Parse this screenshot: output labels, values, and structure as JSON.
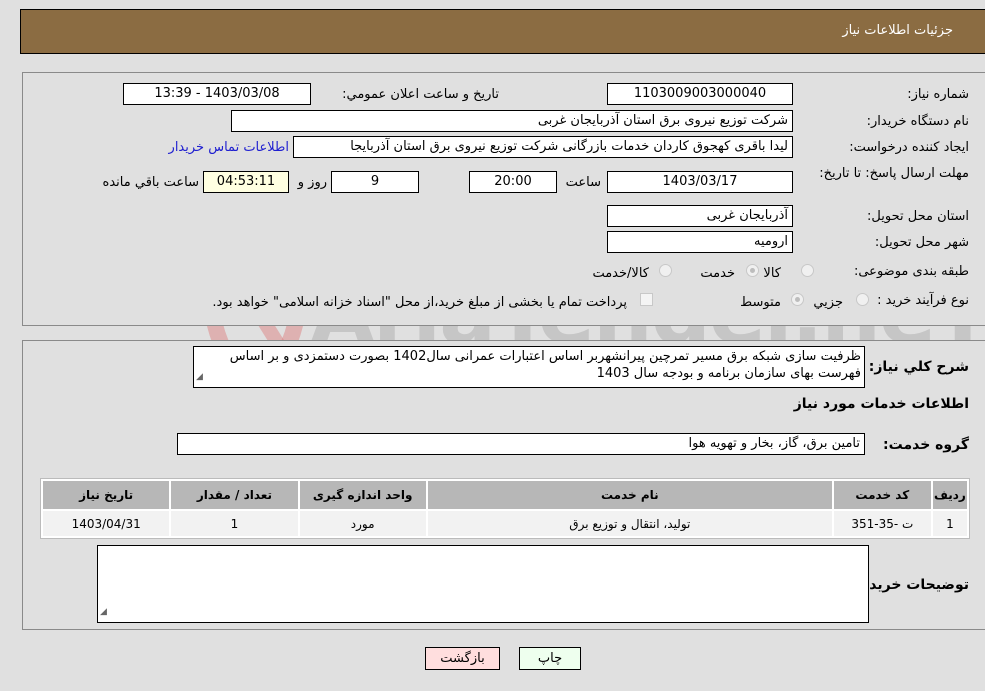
{
  "header": {
    "title": "جزئیات اطلاعات نیاز"
  },
  "details": {
    "need_number": {
      "label": "شماره نیاز:",
      "value": "1103009003000040"
    },
    "announce_datetime": {
      "label": "تاريخ و ساعت اعلان عمومي:",
      "value": "1403/03/08 - 13:39"
    },
    "buyer_org": {
      "label": "نام دستگاه خريدار:",
      "value": "شرکت توزیع نیروی برق استان آذربایجان غربی"
    },
    "requester": {
      "label": "ايجاد کننده درخواست:",
      "value": "لیدا باقری کهجوق کاردان خدمات بازرگانی شرکت توزیع نیروی برق استان آذربایجا"
    },
    "buyer_contact_link": "اطلاعات تماس خريدار",
    "deadline": {
      "label": "مهلت ارسال پاسخ: تا تاريخ:",
      "date": "1403/03/17",
      "time_label": "ساعت",
      "time": "20:00",
      "days": "9",
      "days_label": "روز و",
      "remaining": "04:53:11",
      "remaining_label": "ساعت باقي مانده"
    },
    "delivery_province": {
      "label": "استان محل تحویل:",
      "value": "آذربایجان غربی"
    },
    "delivery_city": {
      "label": "شهر محل تحویل:",
      "value": "اروميه"
    },
    "category": {
      "label": "طبقه بندی موضوعی:",
      "options": [
        "کالا",
        "خدمت",
        "کالا/خدمت"
      ],
      "selected": "خدمت"
    },
    "purchase_type": {
      "label": "نوع فرآيند خريد :",
      "options": [
        "جزيي",
        "متوسط"
      ],
      "selected": "متوسط",
      "treasury_note": "پرداخت تمام يا بخشی از مبلغ خريد،از محل \"اسناد خزانه اسلامی\" خواهد بود."
    }
  },
  "description": {
    "label": "شرح کلي نياز:",
    "value": "ظرفیت سازی شبکه  برق مسیر تمرچین پیرانشهربر اساس اعتبارات عمرانی  سال1402 بصورت دستمزدی  و بر اساس فهرست بهای سازمان برنامه و بودجه سال 1403"
  },
  "services": {
    "section_title": "اطلاعات خدمات مورد نياز",
    "group_label": "گروه خدمت:",
    "group_value": "تامين برق، گاز، بخار و تهويه هوا",
    "table": {
      "headers": [
        "رديف",
        "کد خدمت",
        "نام خدمت",
        "واحد اندازه گيری",
        "تعداد / مقدار",
        "تاريخ نياز"
      ],
      "rows": [
        [
          "1",
          "ت -35-351",
          "توليد، انتقال و توزيع برق",
          "مورد",
          "1",
          "1403/04/31"
        ]
      ]
    }
  },
  "buyer_notes": {
    "label": "توضيحات خريدار:",
    "value": ""
  },
  "buttons": {
    "print": "چاپ",
    "back": "بازگشت"
  },
  "watermark": {
    "text": "AriaTender.neT"
  }
}
